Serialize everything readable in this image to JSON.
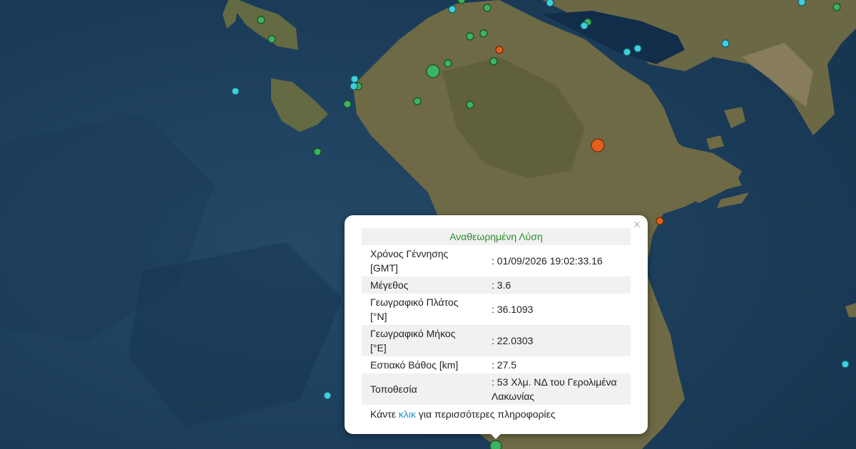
{
  "popup": {
    "title": "Αναθεωρημένη Λύση",
    "close_label": "×",
    "rows": [
      {
        "label": "Χρόνος Γέννησης [GMT]",
        "value": ": 01/09/2026 19:02:33.16"
      },
      {
        "label": "Μέγεθος",
        "value": ": 3.6"
      },
      {
        "label": "Γεωγραφικό Πλάτος [°N]",
        "value": ": 36.1093"
      },
      {
        "label": "Γεωγραφικό Μήκος [°E]",
        "value": ": 22.0303"
      },
      {
        "label": "Εστιακό Βάθος [km]",
        "value": ": 27.5"
      },
      {
        "label": "Τοποθεσία",
        "value": ": 53 Χλμ. ΝΔ του Γερολιμένα Λακωνίας"
      }
    ],
    "footer_before": "Κάντε ",
    "footer_link": "κλικ",
    "footer_after": " για περισσότερες πληροφορίες"
  },
  "colors": {
    "sea": "#1d3f5c",
    "land": "#6e6a45",
    "marker_green": "#3cb35f",
    "marker_cyan": "#3fd0df",
    "marker_orange": "#e2601c",
    "title_green": "#2e8b2e",
    "link_blue": "#1a8fc9"
  }
}
